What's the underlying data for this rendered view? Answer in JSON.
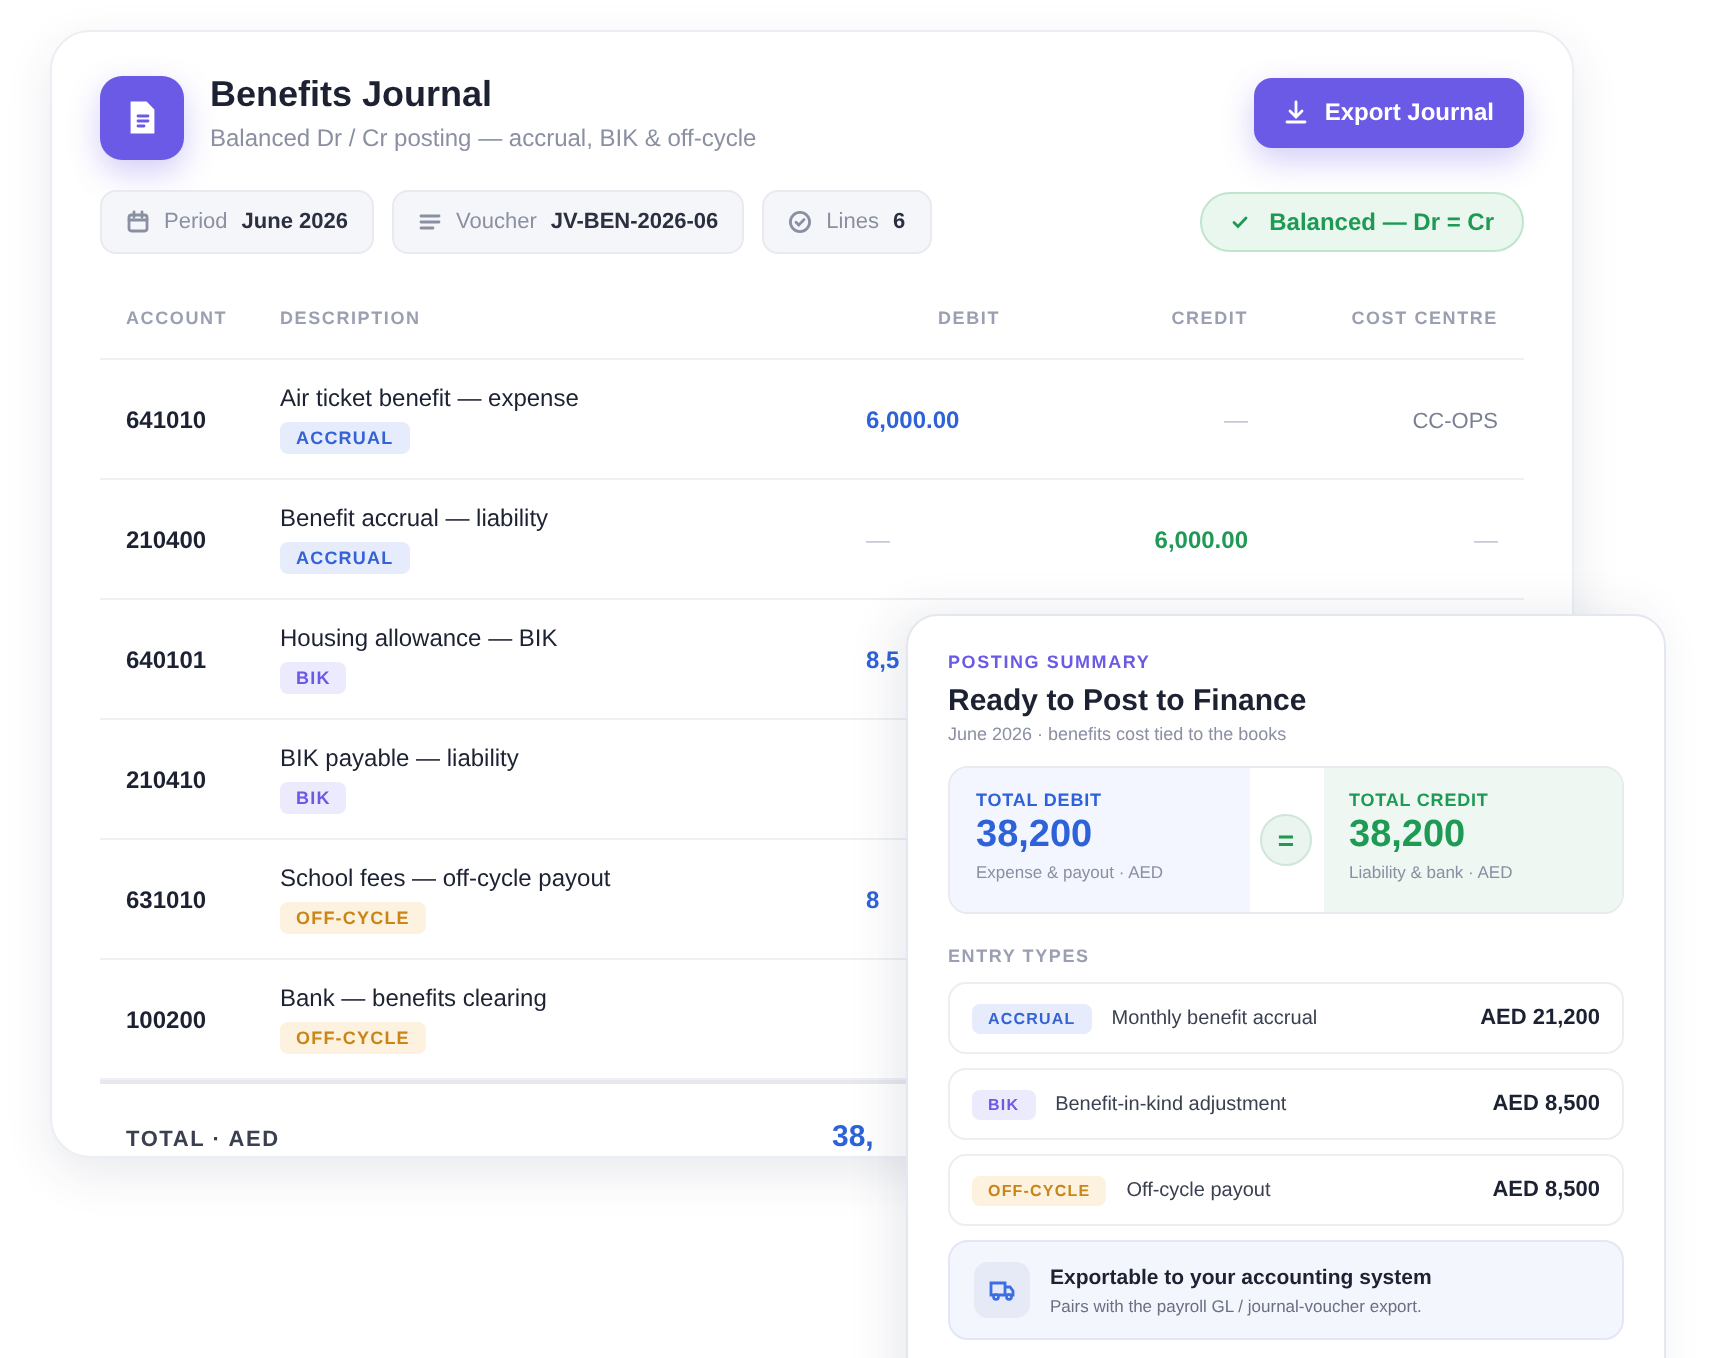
{
  "journal": {
    "title": "Benefits Journal",
    "subtitle": "Balanced Dr / Cr posting — accrual, BIK & off-cycle",
    "export_button": "Export Journal",
    "chips": [
      {
        "kind": "calendar",
        "label": "Period",
        "value": "June 2026"
      },
      {
        "kind": "lines",
        "label": "Voucher",
        "value": "JV-BEN-2026-06"
      },
      {
        "kind": "check",
        "label": "Lines",
        "value": "6"
      }
    ],
    "status": "Balanced — Dr = Cr",
    "table": {
      "columns": [
        "ACCOUNT",
        "DESCRIPTION",
        "DEBIT",
        "CREDIT",
        "COST CENTRE"
      ],
      "rows": [
        {
          "account": "641010",
          "description": "Air ticket benefit — expense",
          "tag": "ACCRUAL",
          "kind": "accrual",
          "debit": "6,000.00",
          "credit": "—",
          "cost_centre": "CC-OPS"
        },
        {
          "account": "210400",
          "description": "Benefit accrual — liability",
          "tag": "ACCRUAL",
          "kind": "accrual",
          "debit": "—",
          "credit": "6,000.00",
          "cost_centre": "—"
        },
        {
          "account": "640101",
          "description": "Housing allowance — BIK",
          "tag": "BIK",
          "kind": "bik",
          "debit": "8,5"
        },
        {
          "account": "210410",
          "description": "BIK payable — liability",
          "tag": "BIK",
          "kind": "bik"
        },
        {
          "account": "631010",
          "description": "School fees — off-cycle payout",
          "tag": "OFF-CYCLE",
          "kind": "offcycle",
          "debit": "8"
        },
        {
          "account": "100200",
          "description": "Bank — benefits clearing",
          "tag": "OFF-CYCLE",
          "kind": "offcycle"
        }
      ],
      "total": {
        "label": "TOTAL · AED",
        "debit": "38,"
      }
    }
  },
  "summary": {
    "eyebrow": "POSTING SUMMARY",
    "title": "Ready to Post to Finance",
    "subtitle": "June 2026 · benefits cost tied to the books",
    "totals": [
      {
        "kind": "debit",
        "label": "TOTAL DEBIT",
        "value": "38,200",
        "note": "Expense & payout · AED"
      },
      {
        "kind": "credit",
        "label": "TOTAL CREDIT",
        "value": "38,200",
        "note": "Liability & bank · AED"
      }
    ],
    "equals": "=",
    "entry_types_label": "ENTRY TYPES",
    "entry_types": [
      {
        "tag": "ACCRUAL",
        "kind": "accrual",
        "label": "Monthly benefit accrual",
        "amount": "AED 21,200"
      },
      {
        "tag": "BIK",
        "kind": "bik",
        "label": "Benefit-in-kind adjustment",
        "amount": "AED 8,500"
      },
      {
        "tag": "OFF-CYCLE",
        "kind": "offcycle",
        "label": "Off-cycle payout",
        "amount": "AED 8,500"
      }
    ],
    "export": {
      "title": "Exportable to your accounting system",
      "text": "Pairs with the payroll GL / journal-voucher export."
    }
  }
}
